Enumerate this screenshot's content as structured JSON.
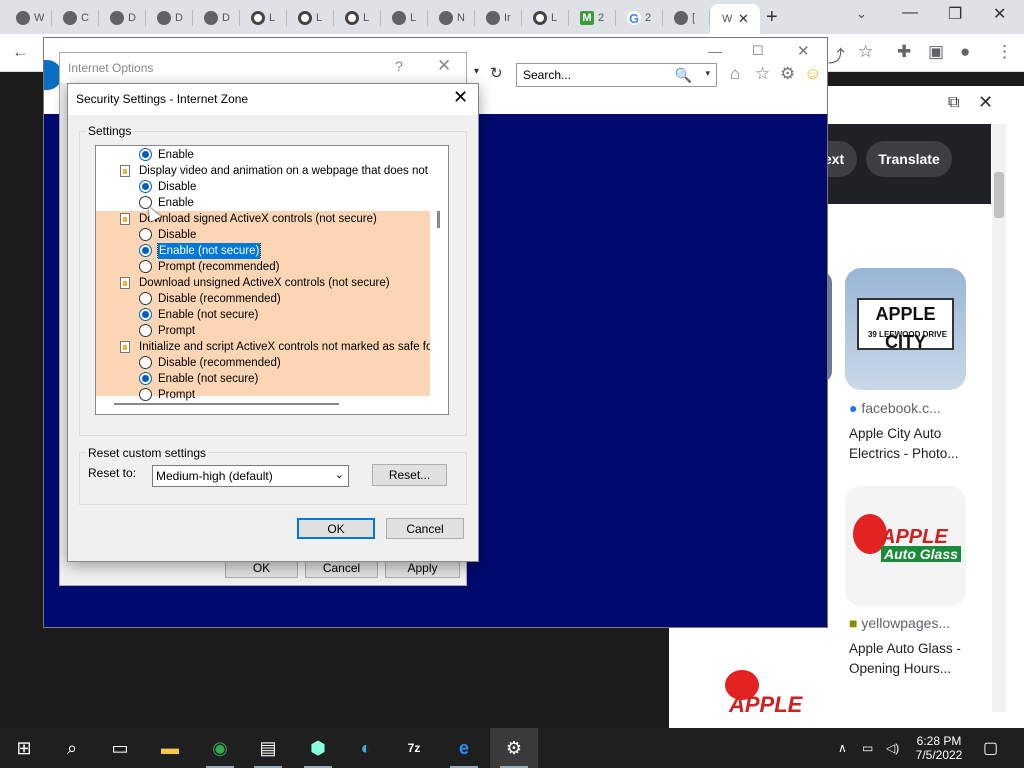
{
  "chrome": {
    "tabs": [
      {
        "label": "W",
        "icon": "wolfram-icon"
      },
      {
        "label": "C",
        "icon": "cloud-icon"
      },
      {
        "label": "D",
        "icon": "globe-icon"
      },
      {
        "label": "D",
        "icon": "globe-icon"
      },
      {
        "label": "D",
        "icon": "globe-icon"
      },
      {
        "label": "L",
        "icon": "camera-icon"
      },
      {
        "label": "L",
        "icon": "camera-icon"
      },
      {
        "label": "L",
        "icon": "camera-icon"
      },
      {
        "label": "L",
        "icon": "globe-icon"
      },
      {
        "label": "N",
        "icon": "globe-icon"
      },
      {
        "label": "Ir",
        "icon": "globe-icon"
      },
      {
        "label": "L",
        "icon": "camera-icon"
      },
      {
        "label": "2",
        "icon": "m-icon",
        "icon_text": "M"
      },
      {
        "label": "2",
        "icon": "google-icon",
        "icon_text": "G"
      },
      {
        "label": "[",
        "icon": "globe-icon"
      }
    ],
    "active_tab": {
      "label": "W",
      "close": "✕"
    },
    "new_tab": "+",
    "tab_search": "⌄",
    "win_min": "—",
    "win_max": "❐",
    "win_close": "✕"
  },
  "ie_window": {
    "search_placeholder": "Search...",
    "search_icon": "🔍",
    "dropdown": "▾",
    "refresh": "↻"
  },
  "internet_options": {
    "title": "Internet Options",
    "help": "?",
    "close": "✕",
    "ok": "OK",
    "cancel": "Cancel",
    "apply": "Apply"
  },
  "security_dialog": {
    "title": "Security Settings - Internet Zone",
    "close": "✕",
    "settings_group": "Settings",
    "rows": [
      {
        "kind": "option",
        "label": "Enable",
        "checked": true
      },
      {
        "kind": "category",
        "label": "Display video and animation on a webpage that does not use"
      },
      {
        "kind": "option",
        "label": "Disable",
        "checked": true
      },
      {
        "kind": "option",
        "label": "Enable",
        "checked": false
      },
      {
        "kind": "category",
        "label": "Download signed ActiveX controls (not secure)"
      },
      {
        "kind": "option",
        "label": "Disable",
        "checked": false
      },
      {
        "kind": "option",
        "label": "Enable (not secure)",
        "checked": true,
        "selected": true
      },
      {
        "kind": "option",
        "label": "Prompt (recommended)",
        "checked": false
      },
      {
        "kind": "category",
        "label": "Download unsigned ActiveX controls (not secure)"
      },
      {
        "kind": "option",
        "label": "Disable (recommended)",
        "checked": false
      },
      {
        "kind": "option",
        "label": "Enable (not secure)",
        "checked": true
      },
      {
        "kind": "option",
        "label": "Prompt",
        "checked": false
      },
      {
        "kind": "category",
        "label": "Initialize and script ActiveX controls not marked as safe for sc"
      },
      {
        "kind": "option",
        "label": "Disable (recommended)",
        "checked": false
      },
      {
        "kind": "option",
        "label": "Enable (not secure)",
        "checked": true
      },
      {
        "kind": "option",
        "label": "Prompt",
        "checked": false
      }
    ],
    "reset_group": "Reset custom settings",
    "reset_to_label": "Reset to:",
    "reset_to_value": "Medium-high (default)",
    "reset_button": "Reset...",
    "ok": "OK",
    "cancel": "Cancel"
  },
  "google_panel": {
    "pill_text": "ext",
    "pill_translate": "Translate",
    "results": [
      {
        "source": "facebook.c...",
        "title": "Apple City Auto Electrics - Photo..."
      },
      {
        "source": "yellowpages...",
        "title": "Apple Auto Glass - Opening Hours..."
      }
    ],
    "sign_line1": "APPLE CITY",
    "sign_line2": "39 LEEWOOD DRIVE",
    "logo_text1": "APPLE",
    "logo_text2": "Auto Glass",
    "logo_text3": "APPLE"
  },
  "taskbar": {
    "time": "6:28 PM",
    "date": "7/5/2022"
  }
}
